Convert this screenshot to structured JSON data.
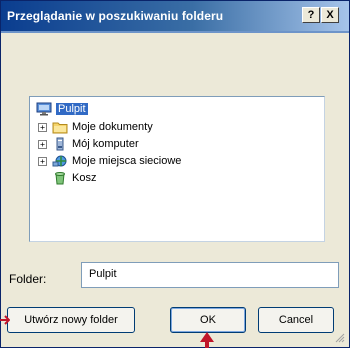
{
  "dialog": {
    "title": "Przeglądanie w poszukiwaniu folderu",
    "help_label": "?",
    "close_label": "X"
  },
  "tree": {
    "items": [
      {
        "label": "Pulpit",
        "icon": "desktop-icon",
        "expander": "",
        "selected": true
      },
      {
        "label": "Moje dokumenty",
        "icon": "folder-icon",
        "expander": "+"
      },
      {
        "label": "Mój komputer",
        "icon": "computer-icon",
        "expander": "+"
      },
      {
        "label": "Moje miejsca sieciowe",
        "icon": "network-icon",
        "expander": "+"
      },
      {
        "label": "Kosz",
        "icon": "recycle-bin-icon",
        "expander": ""
      }
    ]
  },
  "folder": {
    "label": "Folder:",
    "value": "Pulpit"
  },
  "buttons": {
    "new_folder": "Utwórz nowy folder",
    "ok": "OK",
    "cancel": "Cancel"
  },
  "colors": {
    "title_start": "#0a3d8f",
    "selection": "#316ac5",
    "arrow": "#c0162a"
  }
}
